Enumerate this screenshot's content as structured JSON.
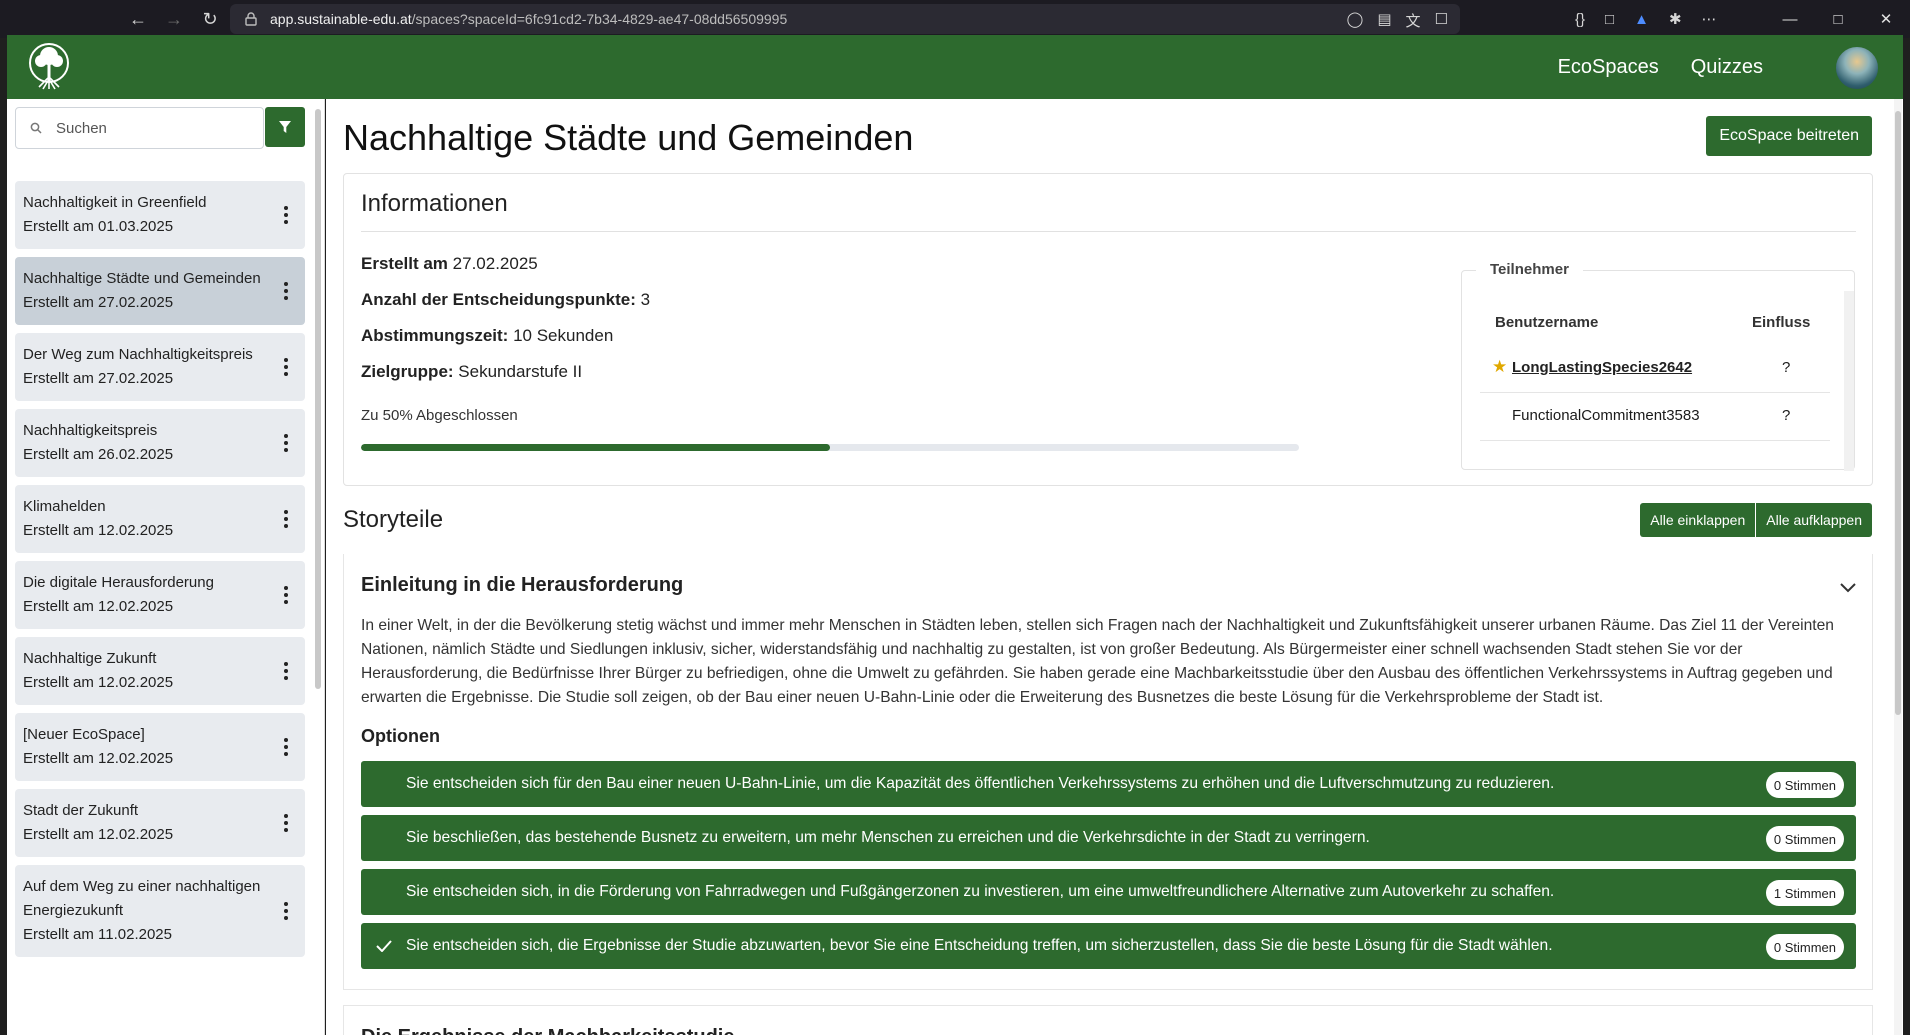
{
  "browser": {
    "url_host": "app.sustainable-edu.at",
    "url_path": "/spaces?spaceId=6fc91cd2-7b34-4829-ae47-08dd56509995"
  },
  "header": {
    "nav": [
      "EcoSpaces",
      "Quizzes"
    ]
  },
  "sidebar": {
    "search_placeholder": "Suchen",
    "items": [
      {
        "name": "Nachhaltigkeit in Greenfield",
        "date": "Erstellt am 01.03.2025"
      },
      {
        "name": "Nachhaltige Städte und Gemeinden",
        "date": "Erstellt am 27.02.2025"
      },
      {
        "name": "Der Weg zum Nachhaltigkeitspreis",
        "date": "Erstellt am 27.02.2025"
      },
      {
        "name": "Nachhaltigkeitspreis",
        "date": "Erstellt am 26.02.2025"
      },
      {
        "name": "Klimahelden",
        "date": "Erstellt am 12.02.2025"
      },
      {
        "name": "Die digitale Herausforderung",
        "date": "Erstellt am 12.02.2025"
      },
      {
        "name": "Nachhaltige Zukunft",
        "date": "Erstellt am 12.02.2025"
      },
      {
        "name": "[Neuer EcoSpace]",
        "date": "Erstellt am 12.02.2025"
      },
      {
        "name": "Stadt der Zukunft",
        "date": "Erstellt am 12.02.2025"
      },
      {
        "name": "Auf dem Weg zu einer nachhaltigen Energiezukunft",
        "date": "Erstellt am 11.02.2025"
      }
    ]
  },
  "main": {
    "title": "Nachhaltige Städte und Gemeinden",
    "join_label": "EcoSpace beitreten",
    "info": {
      "title": "Informationen",
      "created_label": "Erstellt am",
      "created_value": "27.02.2025",
      "decision_label": "Anzahl der Entscheidungspunkte:",
      "decision_value": "3",
      "voting_label": "Abstimmungszeit:",
      "voting_value": "10 Sekunden",
      "target_label": "Zielgruppe:",
      "target_value": "Sekundarstufe II",
      "progress_text": "Zu 50% Abgeschlossen",
      "progress_percent": 50
    },
    "participants": {
      "legend": "Teilnehmer",
      "col_user": "Benutzername",
      "col_influence": "Einfluss",
      "rows": [
        {
          "name": "LongLastingSpecies2642",
          "influence": "?"
        },
        {
          "name": "FunctionalCommitment3583",
          "influence": "?"
        }
      ]
    },
    "story": {
      "title": "Storyteile",
      "collapse_all": "Alle einklappen",
      "expand_all": "Alle aufklappen",
      "part1_title": "Einleitung in die Herausforderung",
      "part1_text": "In einer Welt, in der die Bevölkerung stetig wächst und immer mehr Menschen in Städten leben, stellen sich Fragen nach der Nachhaltigkeit und Zukunftsfähigkeit unserer urbanen Räume. Das Ziel 11 der Vereinten Nationen, nämlich Städte und Siedlungen inklusiv, sicher, widerstandsfähig und nachhaltig zu gestalten, ist von großer Bedeutung. Als Bürgermeister einer schnell wachsenden Stadt stehen Sie vor der Herausforderung, die Bedürfnisse Ihrer Bürger zu befriedigen, ohne die Umwelt zu gefährden. Sie haben gerade eine Machbarkeitsstudie über den Ausbau des öffentlichen Verkehrssystems in Auftrag gegeben und erwarten die Ergebnisse. Die Studie soll zeigen, ob der Bau einer neuen U-Bahn-Linie oder die Erweiterung des Busnetzes die beste Lösung für die Verkehrsprobleme der Stadt ist.",
      "options_label": "Optionen",
      "options": [
        {
          "text": "Sie entscheiden sich für den Bau einer neuen U-Bahn-Linie, um die Kapazität des öffentlichen Verkehrssystems zu erhöhen und die Luftverschmutzung zu reduzieren.",
          "votes": "0 Stimmen"
        },
        {
          "text": "Sie beschließen, das bestehende Busnetz zu erweitern, um mehr Menschen zu erreichen und die Verkehrsdichte in der Stadt zu verringern.",
          "votes": "0 Stimmen"
        },
        {
          "text": "Sie entscheiden sich, in die Förderung von Fahrradwegen und Fußgängerzonen zu investieren, um eine umweltfreundlichere Alternative zum Autoverkehr zu schaffen.",
          "votes": "1 Stimmen"
        },
        {
          "text": "Sie entscheiden sich, die Ergebnisse der Studie abzuwarten, bevor Sie eine Entscheidung treffen, um sicherzustellen, dass Sie die beste Lösung für die Stadt wählen.",
          "votes": "0 Stimmen"
        }
      ],
      "part2_title": "Die Ergebnisse der Machbarkeitsstudie"
    }
  },
  "colors": {
    "brand_green": "#2d6a2e",
    "star": "#e0a800"
  }
}
